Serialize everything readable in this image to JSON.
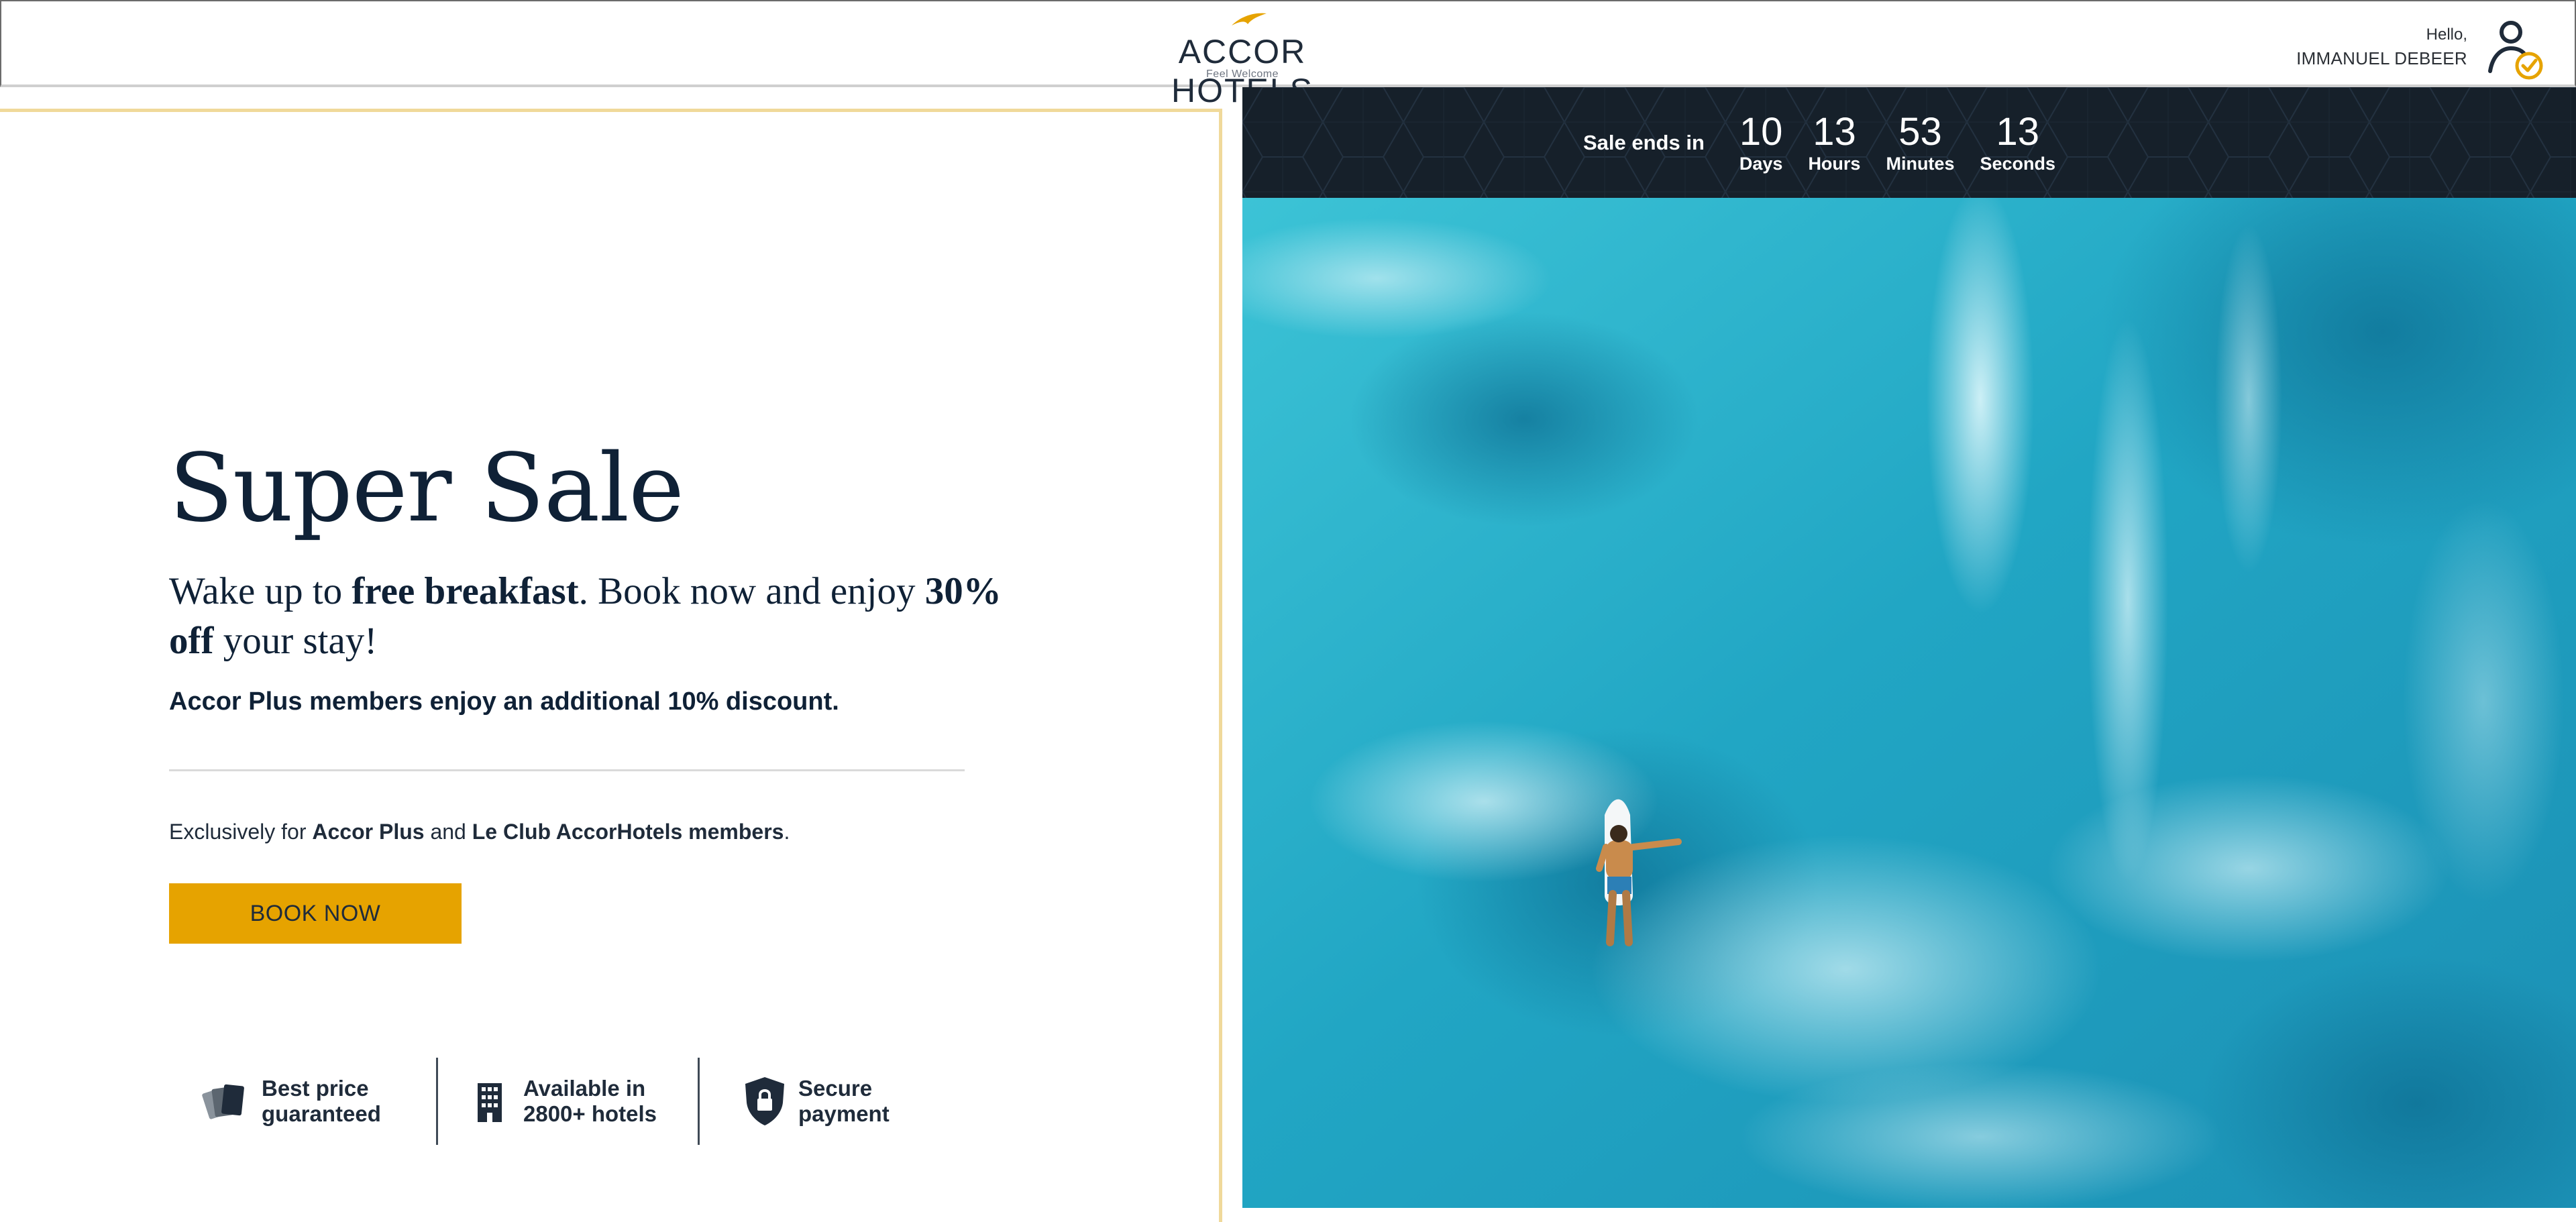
{
  "header": {
    "logo_text": "ACCOR HOTELS",
    "logo_tagline": "Feel Welcome",
    "greeting": "Hello,",
    "username": "IMMANUEL DEBEER",
    "icons": {
      "logo_bird": "bird-icon",
      "user": "user-check-icon"
    }
  },
  "hero": {
    "title": "Super Sale",
    "subtitle_part1": "Wake up to ",
    "subtitle_bold1": "free breakfast",
    "subtitle_part2": ". Book now and enjoy ",
    "subtitle_bold2": "30% off",
    "subtitle_part3": " your stay!",
    "members_note": "Accor Plus members enjoy an additional 10% discount.",
    "exclusive_prefix": "Exclusively for ",
    "exclusive_bold1": "Accor Plus",
    "exclusive_and": " and ",
    "exclusive_bold2": "Le Club AccorHotels members",
    "exclusive_suffix": ".",
    "book_button": "BOOK NOW"
  },
  "features": [
    {
      "icon": "cards-icon",
      "label": "Best price\nguaranteed"
    },
    {
      "icon": "building-icon",
      "label": "Available in\n2800+ hotels"
    },
    {
      "icon": "shield-lock-icon",
      "label": "Secure\npayment"
    }
  ],
  "countdown": {
    "label": "Sale ends in",
    "units": [
      {
        "value": "10",
        "label": "Days"
      },
      {
        "value": "13",
        "label": "Hours"
      },
      {
        "value": "53",
        "label": "Minutes"
      },
      {
        "value": "13",
        "label": "Seconds"
      }
    ]
  },
  "colors": {
    "accent": "#e6a300",
    "navy": "#0f2136",
    "countdown_bg": "#16202a",
    "panel_border": "#f0d99a",
    "ocean": "#2fb8cf"
  }
}
